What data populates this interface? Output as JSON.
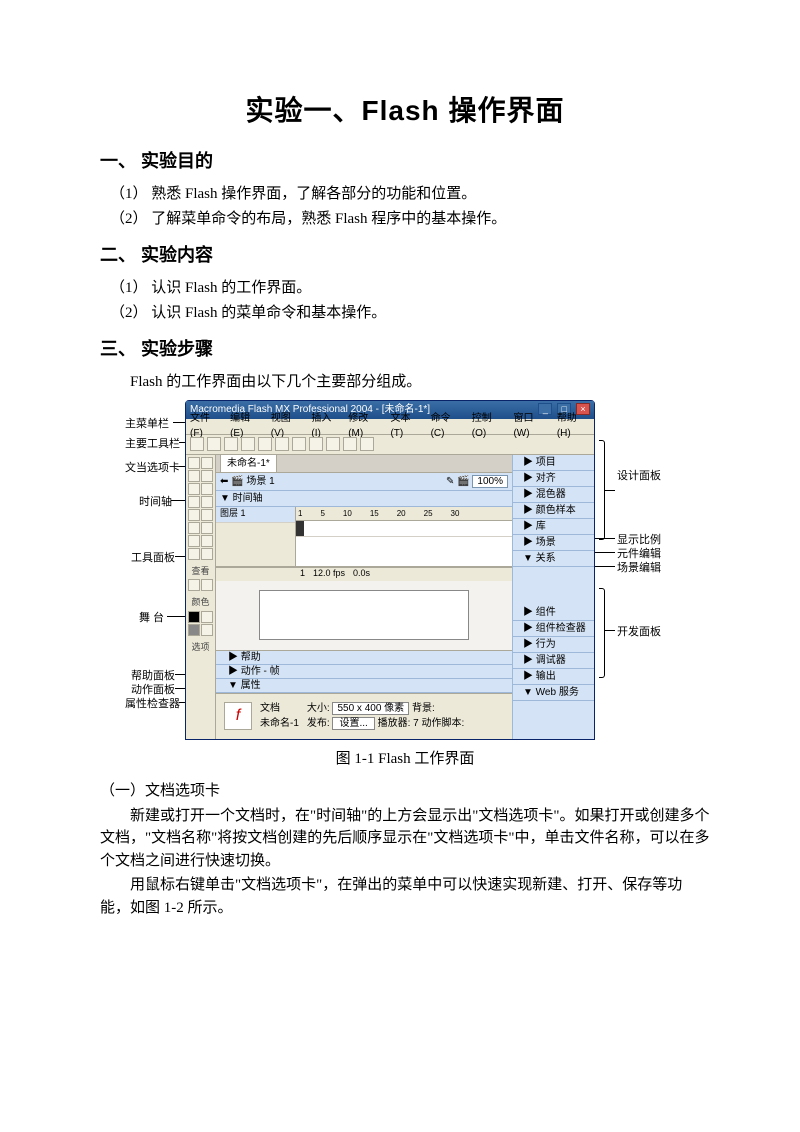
{
  "title": "实验一、Flash 操作界面",
  "s1": {
    "h": "一、 实验目的",
    "i1": "（1） 熟悉 Flash 操作界面，了解各部分的功能和位置。",
    "i2": "（2） 了解菜单命令的布局，熟悉 Flash 程序中的基本操作。"
  },
  "s2": {
    "h": "二、 实验内容",
    "i1": "（1） 认识 Flash 的工作界面。",
    "i2": "（2） 认识 Flash 的菜单命令和基本操作。"
  },
  "s3": {
    "h": "三、 实验步骤",
    "intro": "Flash 的工作界面由以下几个主要部分组成。"
  },
  "fig": {
    "caption": "图 1-1  Flash 工作界面",
    "wintitle": "Macromedia Flash MX Professional 2004 - [未命名-1*]",
    "menus": [
      "文件(F)",
      "编辑(E)",
      "视图(V)",
      "插入(I)",
      "修改(M)",
      "文本(T)",
      "命令(C)",
      "控制(O)",
      "窗口(W)",
      "帮助(H)"
    ],
    "doctab": "未命名-1*",
    "scene": "场景 1",
    "zoom": "100%",
    "timeline_label": "▼ 时间轴",
    "layer1": "图层 1",
    "ruler": [
      "1",
      "5",
      "10",
      "15",
      "20",
      "25",
      "30"
    ],
    "tlfoot": {
      "frame": "1",
      "fps": "12.0 fps",
      "time": "0.0s"
    },
    "bottom": {
      "help": "▶ 帮助",
      "action": "▶ 动作 - 帧",
      "prop": "▼ 属性"
    },
    "props": {
      "doc": "文档",
      "docname": "未命名-1",
      "size_l": "大小:",
      "size_v": "550 x 400 像素",
      "bg": "背景:",
      "pub": "发布:",
      "set": "设置...",
      "player": "播放器: 7",
      "as": "动作脚本:"
    },
    "tool_sections": {
      "view": "查看",
      "color": "颜色",
      "opt": "选项"
    },
    "rpanels_design": [
      "▶ 项目",
      "▶ 对齐",
      "▶ 混色器",
      "▶ 颜色样本",
      "▶ 库",
      "▶ 场景",
      "▼ 关系"
    ],
    "rpanels_dev": [
      "▶ 组件",
      "▶ 组件检查器",
      "▶ 行为",
      "▶ 调试器",
      "▶ 输出",
      "▼ Web 服务"
    ],
    "left_labels": {
      "menubar": "主菜单栏",
      "toolbar": "主要工具栏",
      "doctab": "文当选项卡",
      "timeline": "时间轴",
      "toolpanel": "工具面板",
      "stage": "舞 台",
      "helppanel": "帮助面板",
      "actionpanel": "动作面板",
      "propinsp": "属性检查器"
    },
    "right_labels": {
      "design": "设计面板",
      "ratio": "显示比例",
      "elemedit": "元件编辑",
      "sceneedit": "场景编辑",
      "dev": "开发面板"
    }
  },
  "sub1": {
    "h": "（一）文档选项卡",
    "p1": "新建或打开一个文档时，在\"时间轴\"的上方会显示出\"文档选项卡\"。如果打开或创建多个文档，\"文档名称\"将按文档创建的先后顺序显示在\"文档选项卡\"中，单击文件名称，可以在多个文档之间进行快速切换。",
    "p2": "用鼠标右键单击\"文档选项卡\"，在弹出的菜单中可以快速实现新建、打开、保存等功能，如图 1-2 所示。"
  }
}
